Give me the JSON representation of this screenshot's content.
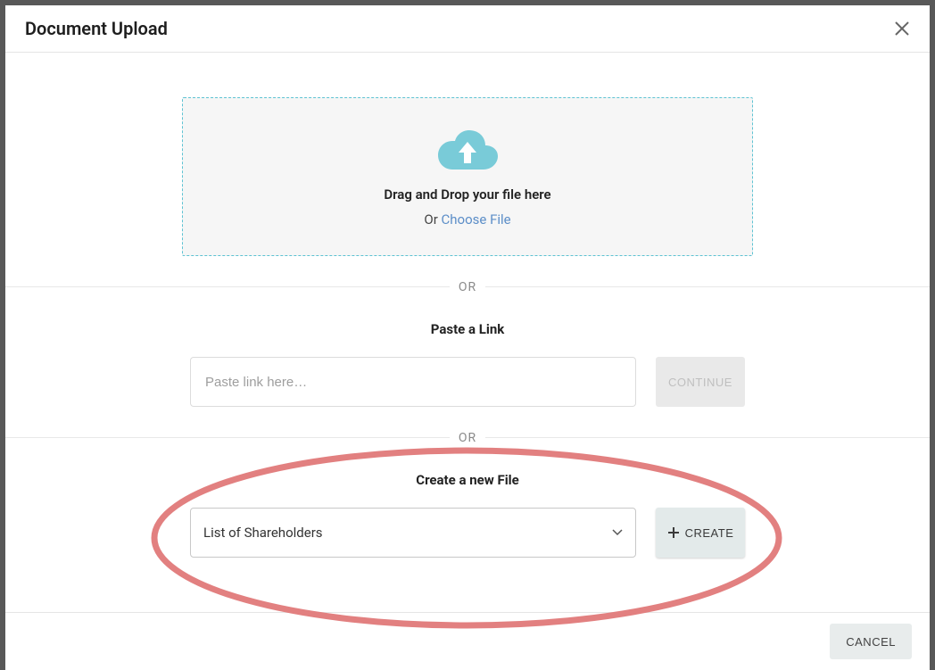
{
  "modal": {
    "title": "Document Upload",
    "dropzone": {
      "line1": "Drag and Drop your file here",
      "or": "Or",
      "choose": "Choose File"
    },
    "separator": "OR",
    "paste": {
      "title": "Paste a Link",
      "placeholder": "Paste link here…",
      "continue_label": "CONTINUE"
    },
    "create_section": {
      "title": "Create a new File",
      "selected": "List of Shareholders",
      "create_label": "CREATE"
    },
    "footer": {
      "cancel_label": "CANCEL"
    }
  }
}
